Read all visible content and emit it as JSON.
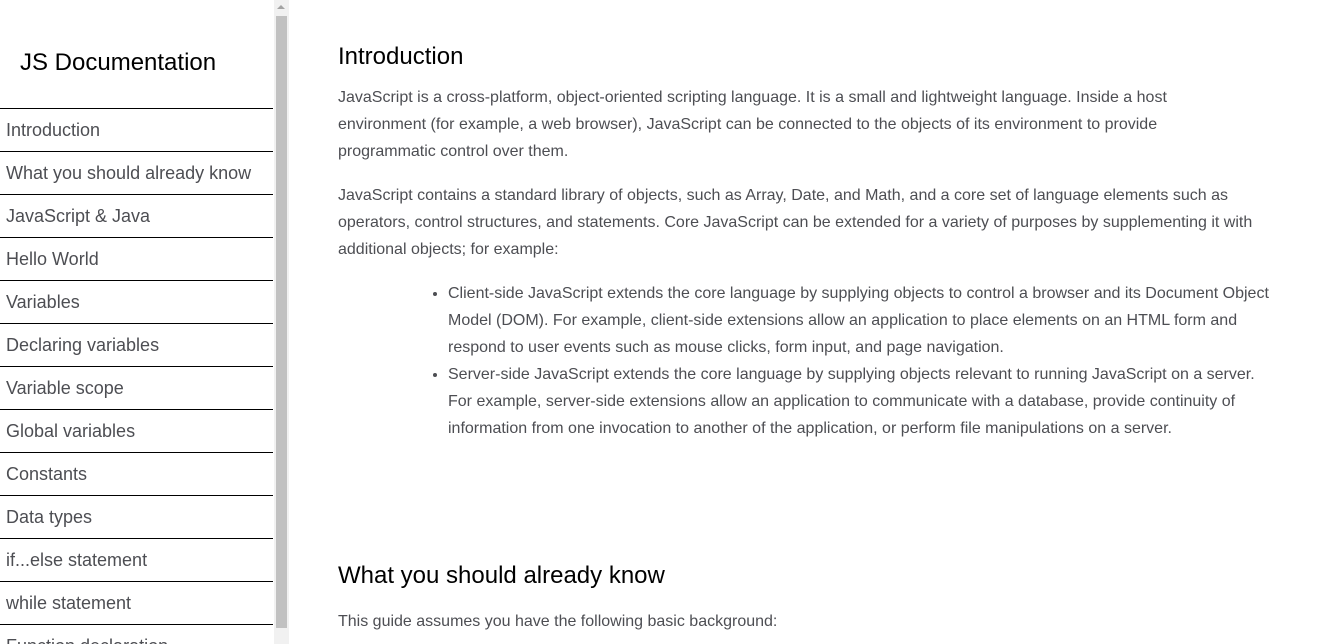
{
  "navbar": {
    "title": "JS Documentation",
    "links": [
      "Introduction",
      "What you should already know",
      "JavaScript & Java",
      "Hello World",
      "Variables",
      "Declaring variables",
      "Variable scope",
      "Global variables",
      "Constants",
      "Data types",
      "if...else statement",
      "while statement",
      "Function declaration"
    ]
  },
  "sections": [
    {
      "header": "Introduction",
      "paragraphs": [
        "JavaScript is a cross-platform, object-oriented scripting language. It is a small and lightweight language. Inside a host environment (for example, a web browser), JavaScript can be connected to the objects of its environment to provide programmatic control over them.",
        "JavaScript contains a standard library of objects, such as Array, Date, and Math, and a core set of language elements such as operators, control structures, and statements. Core JavaScript can be extended for a variety of purposes by supplementing it with additional objects; for example:"
      ],
      "bullets": [
        "Client-side JavaScript extends the core language by supplying objects to control a browser and its Document Object Model (DOM). For example, client-side extensions allow an application to place elements on an HTML form and respond to user events such as mouse clicks, form input, and page navigation.",
        "Server-side JavaScript extends the core language by supplying objects relevant to running JavaScript on a server. For example, server-side extensions allow an application to communicate with a database, provide continuity of information from one invocation to another of the application, or perform file manipulations on a server."
      ]
    },
    {
      "header": "What you should already know",
      "paragraphs": [
        "This guide assumes you have the following basic background:"
      ]
    }
  ]
}
